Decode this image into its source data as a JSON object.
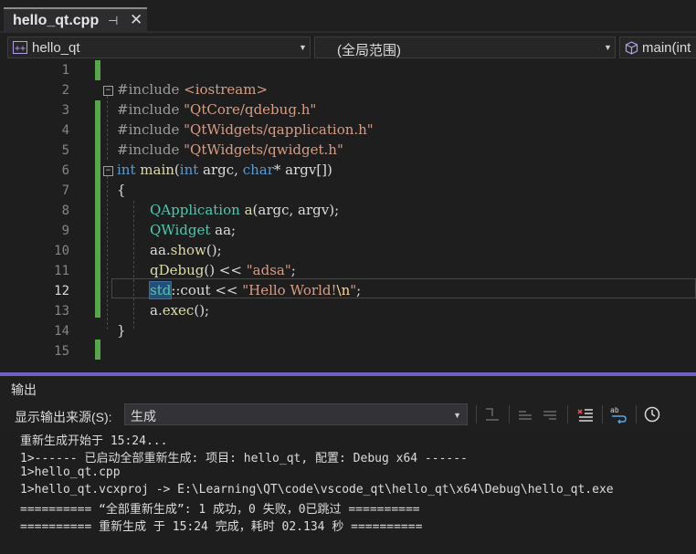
{
  "tab": {
    "title": "hello_qt.cpp",
    "pin": "⊣",
    "close": "✕"
  },
  "navbar": {
    "project": "hello_qt",
    "scope": "(全局范围)",
    "member": "main(int"
  },
  "editor": {
    "line_numbers": [
      "1",
      "2",
      "3",
      "4",
      "5",
      "6",
      "7",
      "8",
      "9",
      "10",
      "11",
      "12",
      "13",
      "14",
      "15"
    ],
    "current_line": "12",
    "code": {
      "l2_pp": "#include ",
      "l2_str": "<iostream>",
      "l3_pp": "#include ",
      "l3_str": "\"QtCore/qdebug.h\"",
      "l4_pp": "#include ",
      "l4_str": "\"QtWidgets/qapplication.h\"",
      "l5_pp": "#include ",
      "l5_str": "\"QtWidgets/qwidget.h\"",
      "l6_kw1": "int",
      "l6_fn": "main",
      "l6_p1": "(",
      "l6_kw2": "int",
      "l6_p2": " argc, ",
      "l6_kw3": "char",
      "l6_p3": "* argv[])",
      "l7": "{",
      "l8_ty": "QApplication",
      "l8_sp": " ",
      "l8_fn": "a",
      "l8_rest": "(argc, argv);",
      "l9_ty": "QWidget",
      "l9_rest": " aa;",
      "l10_a": "aa.",
      "l10_fn": "show",
      "l10_rest": "();",
      "l11_fn": "qDebug",
      "l11_op": "() << ",
      "l11_str": "\"adsa\"",
      "l11_end": ";",
      "l12_hl": "std",
      "l12_mid": "::cout << ",
      "l12_str": "\"Hello World!",
      "l12_esc": "\\n",
      "l12_q": "\"",
      "l12_end": ";",
      "l13_a": "a.",
      "l13_fn": "exec",
      "l13_rest": "();",
      "l14": "}"
    }
  },
  "output": {
    "title": "输出",
    "source_label": "显示输出来源(S):",
    "source_value": "生成",
    "lines": [
      "重新生成开始于 15:24...",
      "1>------ 已启动全部重新生成: 项目: hello_qt, 配置: Debug x64 ------",
      "1>hello_qt.cpp",
      "1>hello_qt.vcxproj -> E:\\Learning\\QT\\code\\vscode_qt\\hello_qt\\x64\\Debug\\hello_qt.exe",
      "========== “全部重新生成”: 1 成功，0 失败，0已跳过 ==========",
      "========== 重新生成 于 15:24 完成，耗时 02.134 秒 =========="
    ]
  },
  "colors": {
    "accent": "#7160c2",
    "keyword": "#569cd6",
    "string": "#d69d85",
    "type": "#4ec9b0",
    "function": "#dcdcaa",
    "change_bar": "#57a64a"
  }
}
